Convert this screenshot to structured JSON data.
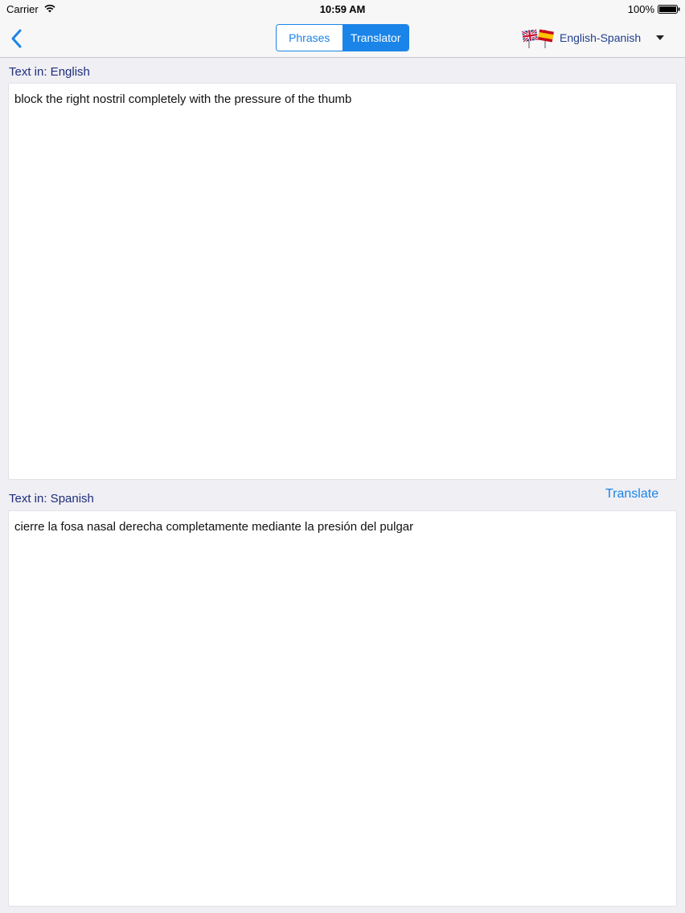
{
  "status_bar": {
    "carrier": "Carrier",
    "time": "10:59 AM",
    "battery_percent": "100%"
  },
  "nav": {
    "back_icon": "chevron-left-icon",
    "segments": [
      {
        "label": "Phrases",
        "selected": false
      },
      {
        "label": "Translator",
        "selected": true
      }
    ],
    "language_pair": "English-Spanish",
    "flags_icon": "uk-spain-flags-icon"
  },
  "source": {
    "label": "Text in: English",
    "text": "block the right nostril completely with the pressure of the thumb"
  },
  "target": {
    "label": "Text in: Spanish",
    "translate_label": "Translate",
    "text": "cierre la fosa nasal derecha completamente mediante la presión del pulgar"
  },
  "colors": {
    "accent": "#1a84e8",
    "label": "#1f2d7a",
    "background": "#efeff4"
  }
}
